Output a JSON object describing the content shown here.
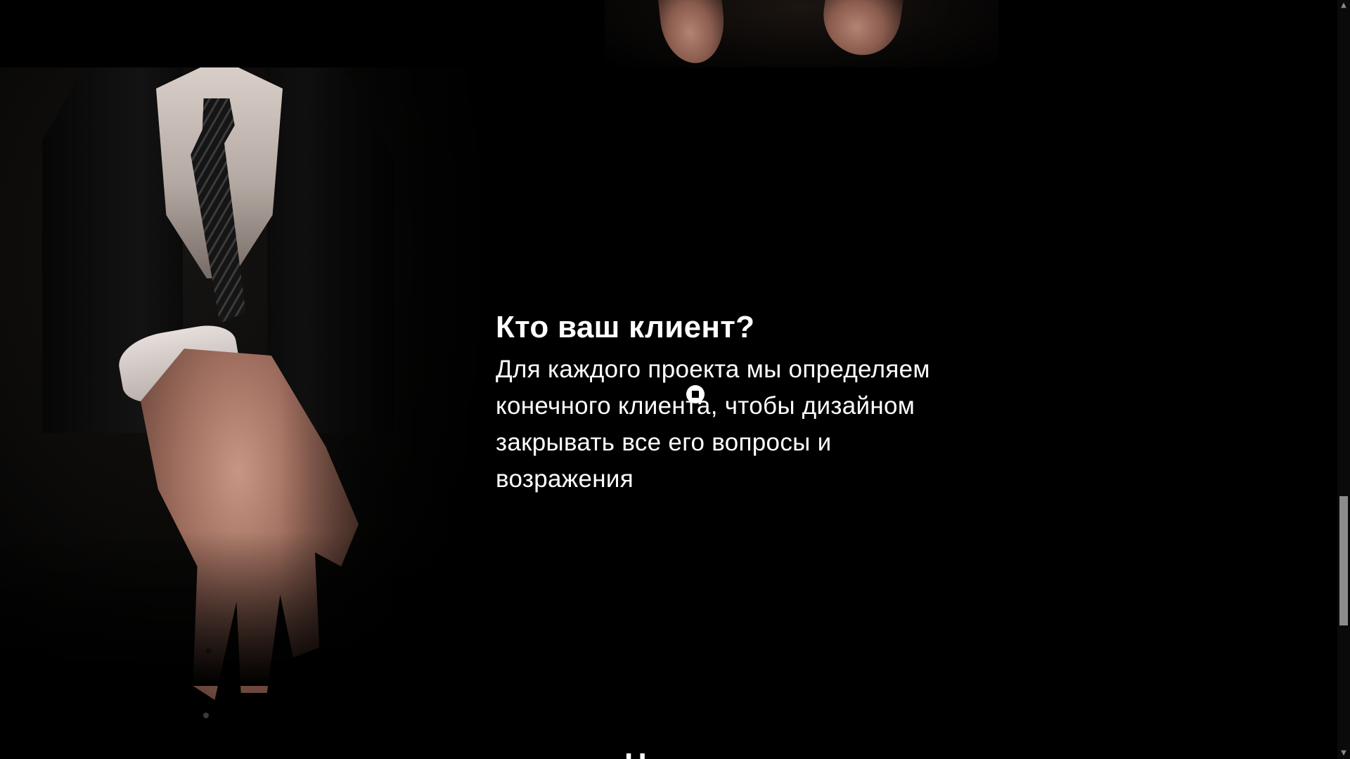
{
  "section": {
    "heading": "Кто ваш клиент?",
    "body": "Для каждого проекта мы определяем конечного клиента, чтобы дизайном закрывать все его вопросы и возражения",
    "next_heading_partial": "Н"
  },
  "images": {
    "top": "hands-photo",
    "left": "man-in-suit-photo"
  },
  "scrollbar": {
    "up_icon": "chevron-up-icon",
    "down_icon": "chevron-down-icon"
  },
  "colors": {
    "background": "#000000",
    "text": "#ffffff",
    "scroll_thumb": "#8b8b8b"
  }
}
